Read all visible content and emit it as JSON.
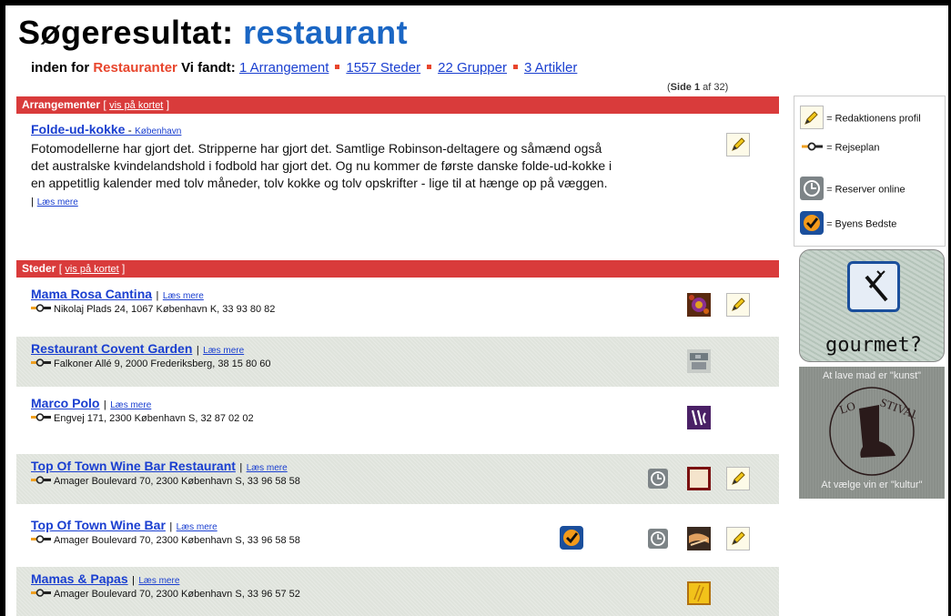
{
  "header": {
    "title_prefix": "Søgeresultat",
    "title_colon": ":",
    "query": "restaurant",
    "scope_label": "inden for",
    "category": "Restauranter",
    "found_label": "Vi fandt:",
    "links": [
      "1 Arrangement",
      "1557 Steder",
      "22 Grupper",
      "3 Artikler"
    ]
  },
  "pager": {
    "open": "(",
    "side_label": "Side",
    "current": "1",
    "of_label": "af 32)"
  },
  "arrangementer": {
    "heading": "Arrangementer",
    "map_link": "vis på kortet",
    "event": {
      "title": "Folde-ud-kokke",
      "sep": " - ",
      "city": "København",
      "description": "Fotomodellerne har gjort det. Stripperne har gjort det. Samtlige Robinson-deltagere og såmænd også det australske kvindelandshold i fodbold har gjort det. Og nu kommer de første danske folde-ud-kokke i en appetitlig kalender med tolv måneder, tolv kokke og tolv opskrifter - lige til at hænge op på væggen.",
      "read_more": "Læs mere"
    }
  },
  "steder": {
    "heading": "Steder",
    "map_link": "vis på kortet",
    "read_more": "Læs mere",
    "rows": [
      {
        "name": "Mama Rosa Cantina",
        "address": "Nikolaj Plads 24, 1067 København K, 33 93 80 82"
      },
      {
        "name": "Restaurant Covent Garden",
        "address": "Falkoner Allé 9, 2000 Frederiksberg, 38 15 80 60"
      },
      {
        "name": "Marco Polo",
        "address": "Engvej 171, 2300 København S, 32 87 02 02"
      },
      {
        "name": "Top Of Town Wine Bar Restaurant",
        "address": "Amager Boulevard 70, 2300 København S, 33 96 58 58"
      },
      {
        "name": "Top Of Town Wine Bar",
        "address": "Amager Boulevard 70, 2300 København S, 33 96 58 58"
      },
      {
        "name": "Mamas & Papas",
        "address": "Amager Boulevard 70, 2300 København S, 33 96 57 52"
      }
    ]
  },
  "legend": {
    "items": [
      {
        "icon": "pencil-icon",
        "label": "= Redaktionens profil"
      },
      {
        "icon": "route-plan-icon",
        "label": "= Rejseplan"
      },
      {
        "icon": "clock-icon",
        "label": "= Reserver online"
      },
      {
        "icon": "check-badge-icon",
        "label": "= Byens Bedste"
      }
    ]
  },
  "ads": {
    "gourmet": {
      "text": "gourmet?"
    },
    "stivale": {
      "top": "At lave mad er \"kunst\"",
      "bottom": "At vælge vin er \"kultur\"",
      "logo": "LO STIVALE"
    }
  },
  "colors": {
    "accent_red": "#d93b3b",
    "link_blue": "#1a3fd0",
    "title_blue": "#1a66c4",
    "category_red": "#e8452c",
    "alt_row": "#dfe3dc"
  }
}
